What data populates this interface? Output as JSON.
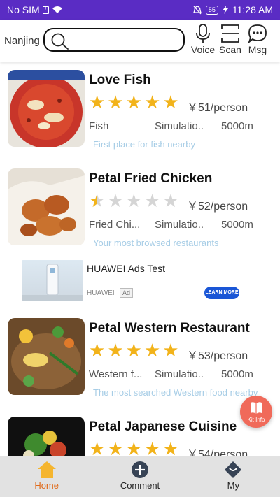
{
  "status_bar": {
    "carrier": "No SIM",
    "battery": "55",
    "time": "11:28 AM"
  },
  "header": {
    "city": "Nanjing",
    "search": {
      "placeholder": ""
    },
    "actions": {
      "voice": "Voice",
      "scan": "Scan",
      "msg": "Msg"
    }
  },
  "restaurants": [
    {
      "name": "Love Fish",
      "rating": 5,
      "price": "￥51/person",
      "category": "Fish",
      "simulation": "Simulatio..",
      "distance": "5000m",
      "tagline": "First place for fish nearby"
    },
    {
      "name": "Petal Fried Chicken",
      "rating": 0.5,
      "price": "￥52/person",
      "category": "Fried Chi...",
      "simulation": "Simulatio..",
      "distance": "5000m",
      "tagline": "Your most browsed restaurants"
    },
    {
      "name": "Petal Western Restaurant",
      "rating": 5,
      "price": "￥53/person",
      "category": "Western f...",
      "simulation": "Simulatio..",
      "distance": "5000m",
      "tagline": "The most searched Western food nearby"
    },
    {
      "name": "Petal Japanese Cuisine",
      "rating": 5,
      "price": "￥54/person"
    }
  ],
  "ad": {
    "title": "HUAWEI Ads Test",
    "source": "HUAWEI",
    "badge": "Ad",
    "cta": "LEARN MORE"
  },
  "kit_info": {
    "label": "Kit Info"
  },
  "bottom_nav": {
    "home": "Home",
    "comment": "Comment",
    "my": "My"
  },
  "colors": {
    "status_bar": "#5a2cc4",
    "star": "#f2b31a",
    "tagline": "#a7cde6",
    "active_nav": "#e06a1a",
    "kit_button": "#f06a5a",
    "ad_cta": "#1a56d6"
  }
}
